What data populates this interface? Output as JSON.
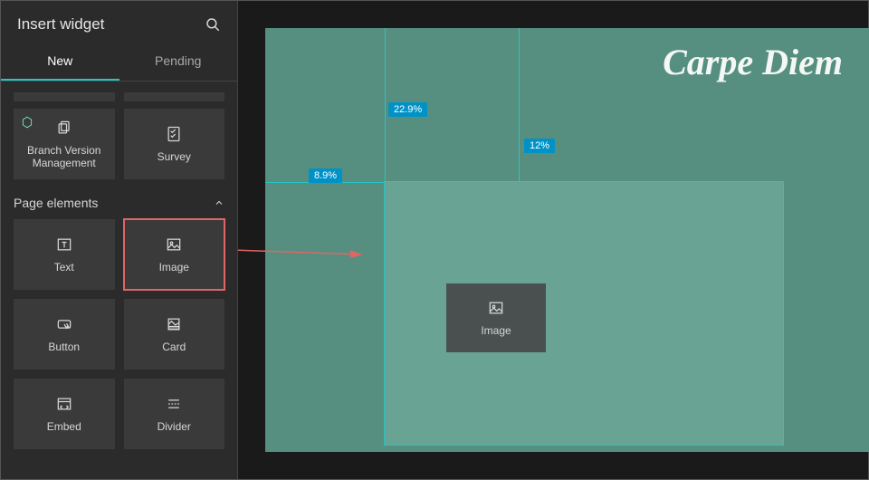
{
  "sidebar": {
    "title": "Insert widget",
    "tabs": [
      {
        "label": "New",
        "active": true
      },
      {
        "label": "Pending",
        "active": false
      }
    ],
    "top_widgets": [
      {
        "id": "branch-version-management",
        "label": "Branch Version Management",
        "beta": true
      },
      {
        "id": "survey",
        "label": "Survey",
        "beta": false
      }
    ],
    "section": {
      "title": "Page elements",
      "items": [
        {
          "id": "text",
          "label": "Text"
        },
        {
          "id": "image",
          "label": "Image",
          "selected": true
        },
        {
          "id": "button",
          "label": "Button"
        },
        {
          "id": "card",
          "label": "Card"
        },
        {
          "id": "embed",
          "label": "Embed"
        },
        {
          "id": "divider",
          "label": "Divider"
        }
      ]
    }
  },
  "canvas": {
    "page_title": "Carpe Diem",
    "guides": {
      "top_offset": "22.9%",
      "left_offset": "8.9%",
      "right_offset": "12%"
    },
    "placeholder": {
      "label": "Image"
    }
  },
  "colors": {
    "accent": "#2ac4c4",
    "selection": "#e06666",
    "badge": "#0092c7",
    "page_bg": "#568f80",
    "dropzone_bg": "#69a393"
  }
}
